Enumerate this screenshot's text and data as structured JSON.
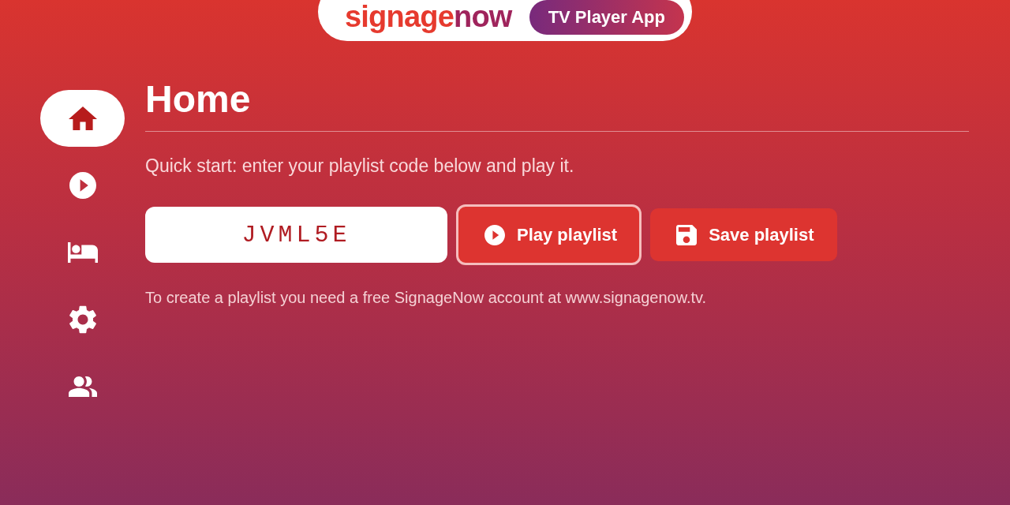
{
  "header": {
    "logo": {
      "first": "signage",
      "second": "now"
    },
    "badge": "TV Player App"
  },
  "sidebar": {
    "items": [
      {
        "kind": "home",
        "selected": true
      },
      {
        "kind": "play",
        "selected": false
      },
      {
        "kind": "bed",
        "selected": false
      },
      {
        "kind": "settings",
        "selected": false
      },
      {
        "kind": "people",
        "selected": false
      }
    ]
  },
  "page": {
    "title": "Home",
    "intro": "Quick start: enter your playlist code below and play it.",
    "code_field": {
      "value": "JVML5E"
    },
    "buttons": [
      {
        "kind": "play",
        "label": "Play playlist",
        "focused": true
      },
      {
        "kind": "save",
        "label": "Save playlist",
        "focused": false
      }
    ],
    "note": "To create a playlist you need a free SignageNow account at www.signagenow.tv."
  }
}
